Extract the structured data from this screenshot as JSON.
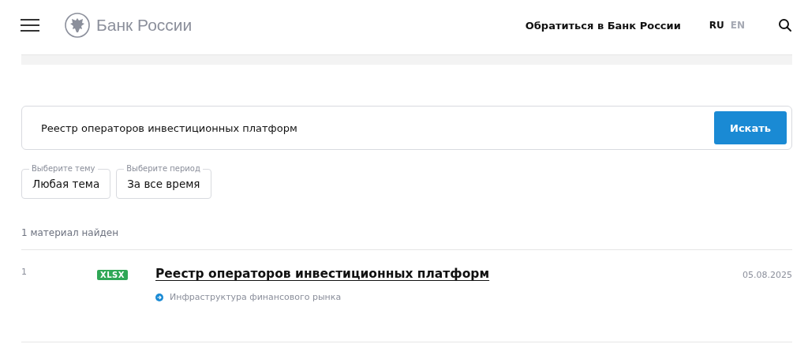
{
  "header": {
    "logo_text": "Банк России",
    "contact_link": "Обратиться в Банк России",
    "languages": [
      {
        "label": "RU",
        "selected": true
      },
      {
        "label": "EN",
        "selected": false
      }
    ]
  },
  "search": {
    "value": "Реестр операторов инвестиционных платформ",
    "button": "Искать"
  },
  "filters": [
    {
      "legend": "Выберите тему",
      "value": "Любая тема"
    },
    {
      "legend": "Выберите период",
      "value": "За все время"
    }
  ],
  "results_count": "1 материал найден",
  "results": [
    {
      "number": "1",
      "format": "XLSX",
      "title": "Реестр операторов инвестиционных платформ",
      "category": "Инфраструктура финансового рынка",
      "date": "05.08.2025"
    }
  ]
}
